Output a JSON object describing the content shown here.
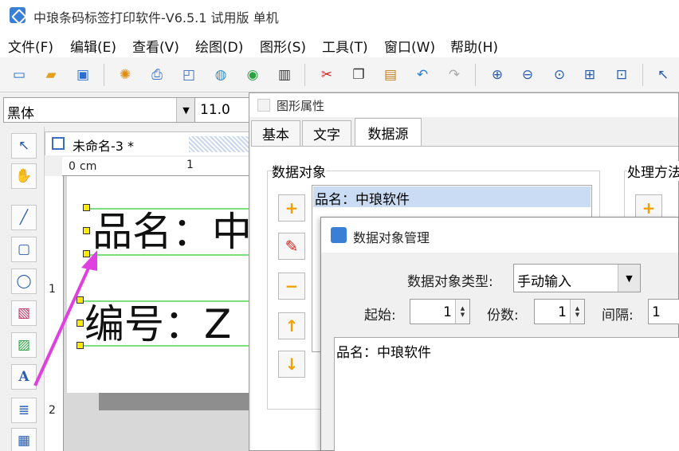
{
  "window": {
    "title": "中琅条码标签打印软件-V6.5.1 试用版 单机"
  },
  "menu": [
    "文件(F)",
    "编辑(E)",
    "查看(V)",
    "绘图(D)",
    "图形(S)",
    "工具(T)",
    "窗口(W)",
    "帮助(H)"
  ],
  "fontbar": {
    "font_name": "黑体",
    "font_size": "11.0"
  },
  "document": {
    "tab_label": "未命名-3 *"
  },
  "ruler": {
    "top_zero": "0",
    "top_unit": "cm",
    "top_one": "1",
    "left_one": "1",
    "left_two": "2"
  },
  "canvas": {
    "line1": "品名：中",
    "line2": "编号：Z"
  },
  "graphic_props": {
    "title": "图形属性",
    "tabs": [
      "基本",
      "文字",
      "数据源"
    ],
    "active_tab": "数据源",
    "data_object_label": "数据对象",
    "processing_label": "处理方法",
    "list_items": [
      "品名：中琅软件"
    ]
  },
  "data_mgr": {
    "title": "数据对象管理",
    "type_label": "数据对象类型:",
    "type_value": "手动输入",
    "start_label": "起始:",
    "start_value": "1",
    "copies_label": "份数:",
    "copies_value": "1",
    "interval_label": "间隔:",
    "interval_value": "1",
    "content": "品名：中琅软件"
  },
  "colors": {
    "accent": "#3a7fd6",
    "selection": "#c9dcf3",
    "handle": "#ffea00",
    "arrow": "#e040e0"
  }
}
